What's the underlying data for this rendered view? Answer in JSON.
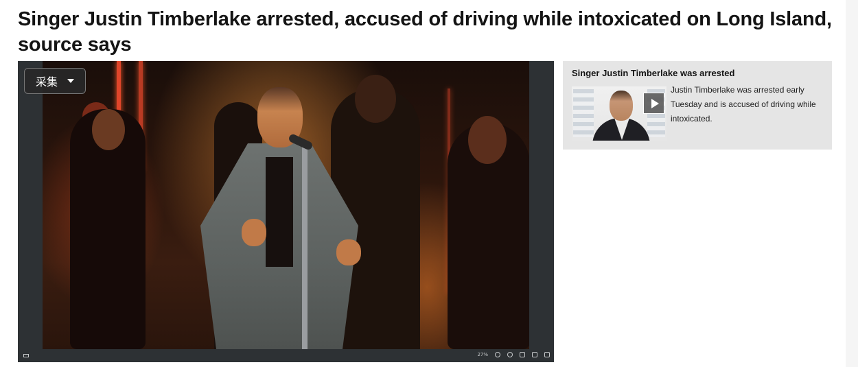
{
  "article": {
    "headline": "Singer Justin Timberlake arrested, accused of driving while intoxicated on Long Island, source says"
  },
  "viewer": {
    "capture_button_label": "采集",
    "zoom_level": "27%"
  },
  "video_card": {
    "title": "Singer Justin Timberlake was arrested",
    "description": "Justin Timberlake was arrested early Tuesday and is accused of driving while intoxicated."
  },
  "icons": {
    "capture_dropdown": "chevron-down-icon",
    "play": "play-icon",
    "zoom_out": "zoom-out-icon",
    "zoom_in": "zoom-in-icon",
    "fit": "fit-icon",
    "actual_size": "actual-size-icon",
    "fullscreen": "fullscreen-icon"
  },
  "colors": {
    "card_background": "#e5e5e5",
    "viewer_background": "#2d3134"
  }
}
